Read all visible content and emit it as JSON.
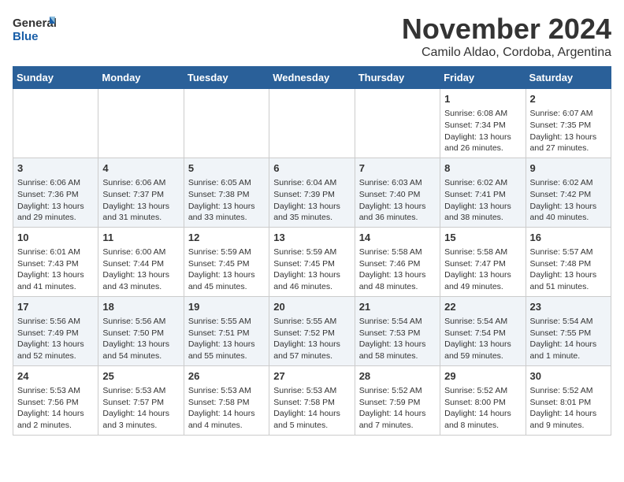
{
  "logo": {
    "general": "General",
    "blue": "Blue"
  },
  "title": "November 2024",
  "subtitle": "Camilo Aldao, Cordoba, Argentina",
  "weekdays": [
    "Sunday",
    "Monday",
    "Tuesday",
    "Wednesday",
    "Thursday",
    "Friday",
    "Saturday"
  ],
  "weeks": [
    [
      {
        "day": "",
        "info": ""
      },
      {
        "day": "",
        "info": ""
      },
      {
        "day": "",
        "info": ""
      },
      {
        "day": "",
        "info": ""
      },
      {
        "day": "",
        "info": ""
      },
      {
        "day": "1",
        "info": "Sunrise: 6:08 AM\nSunset: 7:34 PM\nDaylight: 13 hours and 26 minutes."
      },
      {
        "day": "2",
        "info": "Sunrise: 6:07 AM\nSunset: 7:35 PM\nDaylight: 13 hours and 27 minutes."
      }
    ],
    [
      {
        "day": "3",
        "info": "Sunrise: 6:06 AM\nSunset: 7:36 PM\nDaylight: 13 hours and 29 minutes."
      },
      {
        "day": "4",
        "info": "Sunrise: 6:06 AM\nSunset: 7:37 PM\nDaylight: 13 hours and 31 minutes."
      },
      {
        "day": "5",
        "info": "Sunrise: 6:05 AM\nSunset: 7:38 PM\nDaylight: 13 hours and 33 minutes."
      },
      {
        "day": "6",
        "info": "Sunrise: 6:04 AM\nSunset: 7:39 PM\nDaylight: 13 hours and 35 minutes."
      },
      {
        "day": "7",
        "info": "Sunrise: 6:03 AM\nSunset: 7:40 PM\nDaylight: 13 hours and 36 minutes."
      },
      {
        "day": "8",
        "info": "Sunrise: 6:02 AM\nSunset: 7:41 PM\nDaylight: 13 hours and 38 minutes."
      },
      {
        "day": "9",
        "info": "Sunrise: 6:02 AM\nSunset: 7:42 PM\nDaylight: 13 hours and 40 minutes."
      }
    ],
    [
      {
        "day": "10",
        "info": "Sunrise: 6:01 AM\nSunset: 7:43 PM\nDaylight: 13 hours and 41 minutes."
      },
      {
        "day": "11",
        "info": "Sunrise: 6:00 AM\nSunset: 7:44 PM\nDaylight: 13 hours and 43 minutes."
      },
      {
        "day": "12",
        "info": "Sunrise: 5:59 AM\nSunset: 7:45 PM\nDaylight: 13 hours and 45 minutes."
      },
      {
        "day": "13",
        "info": "Sunrise: 5:59 AM\nSunset: 7:45 PM\nDaylight: 13 hours and 46 minutes."
      },
      {
        "day": "14",
        "info": "Sunrise: 5:58 AM\nSunset: 7:46 PM\nDaylight: 13 hours and 48 minutes."
      },
      {
        "day": "15",
        "info": "Sunrise: 5:58 AM\nSunset: 7:47 PM\nDaylight: 13 hours and 49 minutes."
      },
      {
        "day": "16",
        "info": "Sunrise: 5:57 AM\nSunset: 7:48 PM\nDaylight: 13 hours and 51 minutes."
      }
    ],
    [
      {
        "day": "17",
        "info": "Sunrise: 5:56 AM\nSunset: 7:49 PM\nDaylight: 13 hours and 52 minutes."
      },
      {
        "day": "18",
        "info": "Sunrise: 5:56 AM\nSunset: 7:50 PM\nDaylight: 13 hours and 54 minutes."
      },
      {
        "day": "19",
        "info": "Sunrise: 5:55 AM\nSunset: 7:51 PM\nDaylight: 13 hours and 55 minutes."
      },
      {
        "day": "20",
        "info": "Sunrise: 5:55 AM\nSunset: 7:52 PM\nDaylight: 13 hours and 57 minutes."
      },
      {
        "day": "21",
        "info": "Sunrise: 5:54 AM\nSunset: 7:53 PM\nDaylight: 13 hours and 58 minutes."
      },
      {
        "day": "22",
        "info": "Sunrise: 5:54 AM\nSunset: 7:54 PM\nDaylight: 13 hours and 59 minutes."
      },
      {
        "day": "23",
        "info": "Sunrise: 5:54 AM\nSunset: 7:55 PM\nDaylight: 14 hours and 1 minute."
      }
    ],
    [
      {
        "day": "24",
        "info": "Sunrise: 5:53 AM\nSunset: 7:56 PM\nDaylight: 14 hours and 2 minutes."
      },
      {
        "day": "25",
        "info": "Sunrise: 5:53 AM\nSunset: 7:57 PM\nDaylight: 14 hours and 3 minutes."
      },
      {
        "day": "26",
        "info": "Sunrise: 5:53 AM\nSunset: 7:58 PM\nDaylight: 14 hours and 4 minutes."
      },
      {
        "day": "27",
        "info": "Sunrise: 5:53 AM\nSunset: 7:58 PM\nDaylight: 14 hours and 5 minutes."
      },
      {
        "day": "28",
        "info": "Sunrise: 5:52 AM\nSunset: 7:59 PM\nDaylight: 14 hours and 7 minutes."
      },
      {
        "day": "29",
        "info": "Sunrise: 5:52 AM\nSunset: 8:00 PM\nDaylight: 14 hours and 8 minutes."
      },
      {
        "day": "30",
        "info": "Sunrise: 5:52 AM\nSunset: 8:01 PM\nDaylight: 14 hours and 9 minutes."
      }
    ]
  ]
}
